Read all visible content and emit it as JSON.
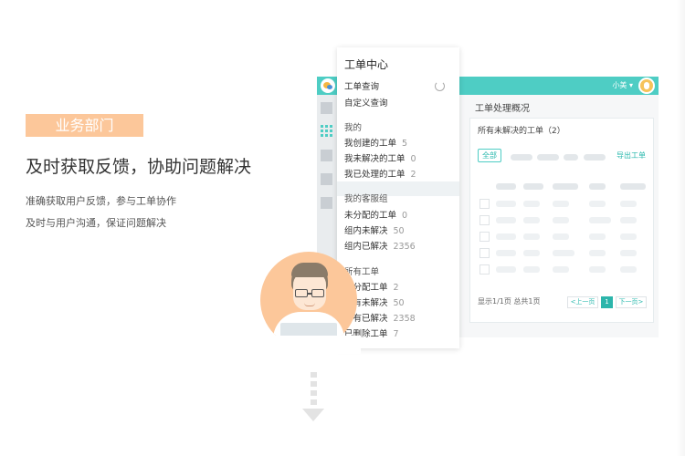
{
  "left": {
    "badge": "业务部门",
    "headline": "及时获取反馈，协助问题解决",
    "desc_lines": [
      "准确获取用户反馈，参与工单协作",
      "及时与用户沟通，保证问题解决"
    ]
  },
  "app": {
    "user_name": "小美 ▾",
    "panel_title": "工单处理概况",
    "panel_sub": "所有未解决的工单（2）",
    "filter_all": "全部",
    "export": "导出工单",
    "page_info": "显示1/1页 总共1页",
    "pager": {
      "prev": "<上一页",
      "current": "1",
      "next": "下一页>"
    },
    "accent": "#4ecdc4"
  },
  "menu": {
    "title": "工单中心",
    "search": "工单查询",
    "custom_search": "自定义查询",
    "mine": {
      "heading": "我的",
      "items": [
        {
          "label": "我创建的工单",
          "count": "5"
        },
        {
          "label": "我未解决的工单",
          "count": "0"
        },
        {
          "label": "我已处理的工单",
          "count": "2"
        }
      ]
    },
    "group": {
      "heading": "我的客服组",
      "items": [
        {
          "label": "未分配的工单",
          "count": "0"
        },
        {
          "label": "组内未解决",
          "count": "50"
        },
        {
          "label": "组内已解决",
          "count": "2356"
        }
      ]
    },
    "all": {
      "heading": "所有工单",
      "items": [
        {
          "label": "未分配工单",
          "count": "2"
        },
        {
          "label": "所有未解决",
          "count": "50"
        },
        {
          "label": "所有已解决",
          "count": "2358"
        },
        {
          "label": "已删除工单",
          "count": "7"
        }
      ]
    }
  }
}
